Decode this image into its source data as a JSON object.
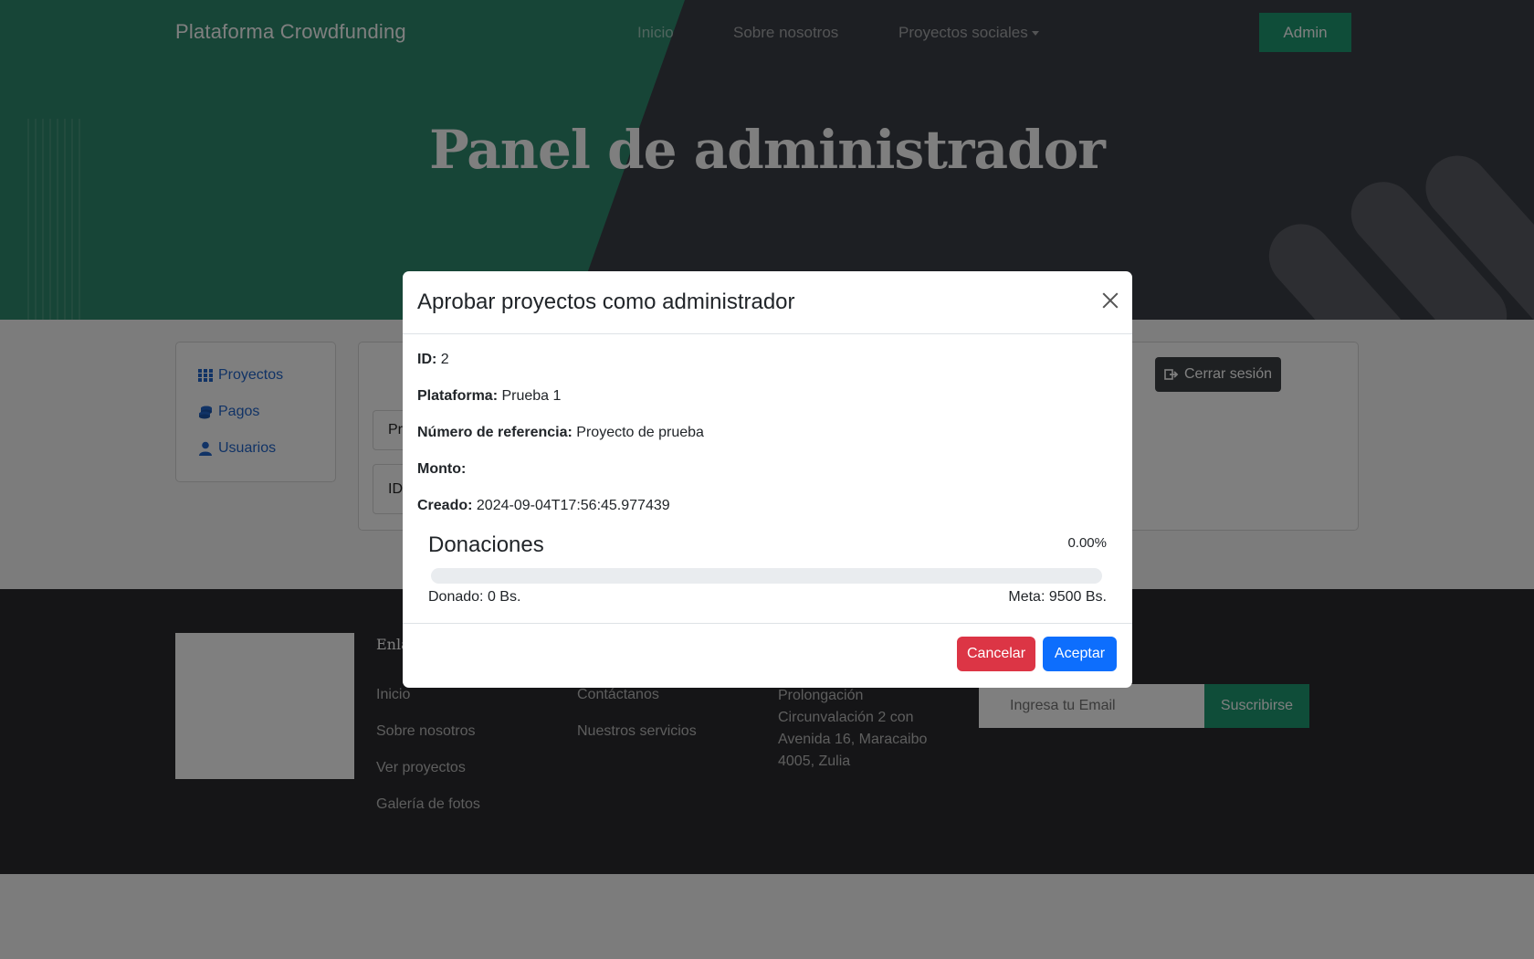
{
  "navbar": {
    "brand": "Plataforma Crowdfunding",
    "links": [
      "Inicio",
      "Sobre nosotros",
      "Proyectos sociales"
    ],
    "admin_label": "Admin"
  },
  "hero": {
    "title": "Panel de administrador"
  },
  "sidebar": {
    "items": [
      {
        "label": "Proyectos",
        "icon": "grid-icon"
      },
      {
        "label": "Pagos",
        "icon": "coins-icon"
      },
      {
        "label": "Usuarios",
        "icon": "user-icon"
      }
    ]
  },
  "content": {
    "logout_label": "Cerrar sesión",
    "box1_text": "Pr",
    "box2_text": "ID"
  },
  "footer": {
    "heading": "Enla",
    "links_col1": [
      "Inicio",
      "Sobre nosotros",
      "Ver proyectos",
      "Galería de fotos"
    ],
    "links_col2": [
      "Contáctanos",
      "Nuestros servicios"
    ],
    "address": "Prolongación Circunvalación 2 con Avenida 16, Maracaibo 4005, Zulia",
    "email_placeholder": "Ingresa tu Email",
    "subscribe_label": "Suscribirse"
  },
  "modal": {
    "title": "Aprobar proyectos como administrador",
    "fields": [
      {
        "label": "ID:",
        "value": "2"
      },
      {
        "label": "Plataforma:",
        "value": "Prueba 1"
      },
      {
        "label": "Número de referencia:",
        "value": "Proyecto de prueba"
      },
      {
        "label": "Monto:",
        "value": ""
      },
      {
        "label": "Creado:",
        "value": "2024-09-04T17:56:45.977439"
      }
    ],
    "donations": {
      "title": "Donaciones",
      "percent_label": "0.00%",
      "progress_fraction": 0.0,
      "donado": "Donado: 0 Bs.",
      "meta": "Meta: 9500 Bs."
    },
    "cancel_label": "Cancelar",
    "accept_label": "Aceptar"
  },
  "colors": {
    "brand_green": "#1f9a72",
    "danger": "#dc3545",
    "primary": "#0d6efd"
  }
}
